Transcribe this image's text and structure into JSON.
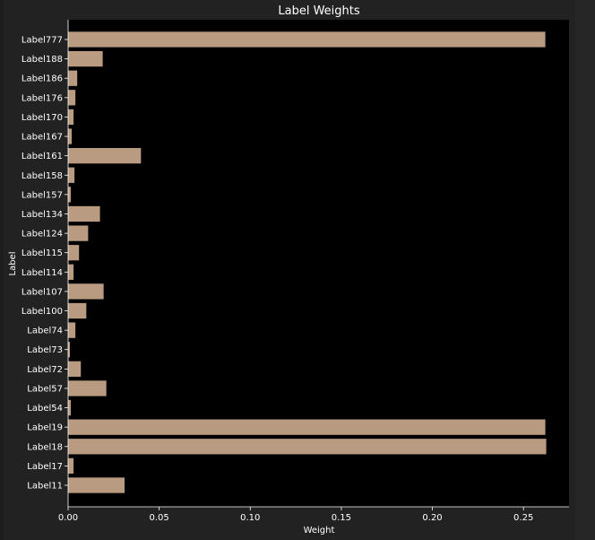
{
  "chart_data": {
    "type": "bar",
    "orientation": "horizontal",
    "title": "Label Weights",
    "xlabel": "Weight",
    "ylabel": "Label",
    "xlim": [
      0,
      0.275
    ],
    "xticks": [
      0.0,
      0.05,
      0.1,
      0.15,
      0.2,
      0.25
    ],
    "xtick_labels": [
      "0.00",
      "0.05",
      "0.10",
      "0.15",
      "0.20",
      "0.25"
    ],
    "categories": [
      "Label777",
      "Label188",
      "Label186",
      "Label176",
      "Label170",
      "Label167",
      "Label161",
      "Label158",
      "Label157",
      "Label134",
      "Label124",
      "Label115",
      "Label114",
      "Label107",
      "Label100",
      "Label74",
      "Label73",
      "Label72",
      "Label57",
      "Label54",
      "Label19",
      "Label18",
      "Label17",
      "Label11"
    ],
    "values": [
      0.262,
      0.019,
      0.005,
      0.004,
      0.003,
      0.002,
      0.04,
      0.0035,
      0.0015,
      0.0175,
      0.011,
      0.006,
      0.003,
      0.0195,
      0.01,
      0.004,
      0.001,
      0.007,
      0.021,
      0.0015,
      0.262,
      0.2625,
      0.003,
      0.031
    ],
    "grid": false,
    "legend": "none",
    "colors": {
      "bar": "#b89b80",
      "plot_background": "#000000",
      "figure_background": "#222222",
      "text": "#ffffff",
      "axis": "#ffffff"
    }
  }
}
